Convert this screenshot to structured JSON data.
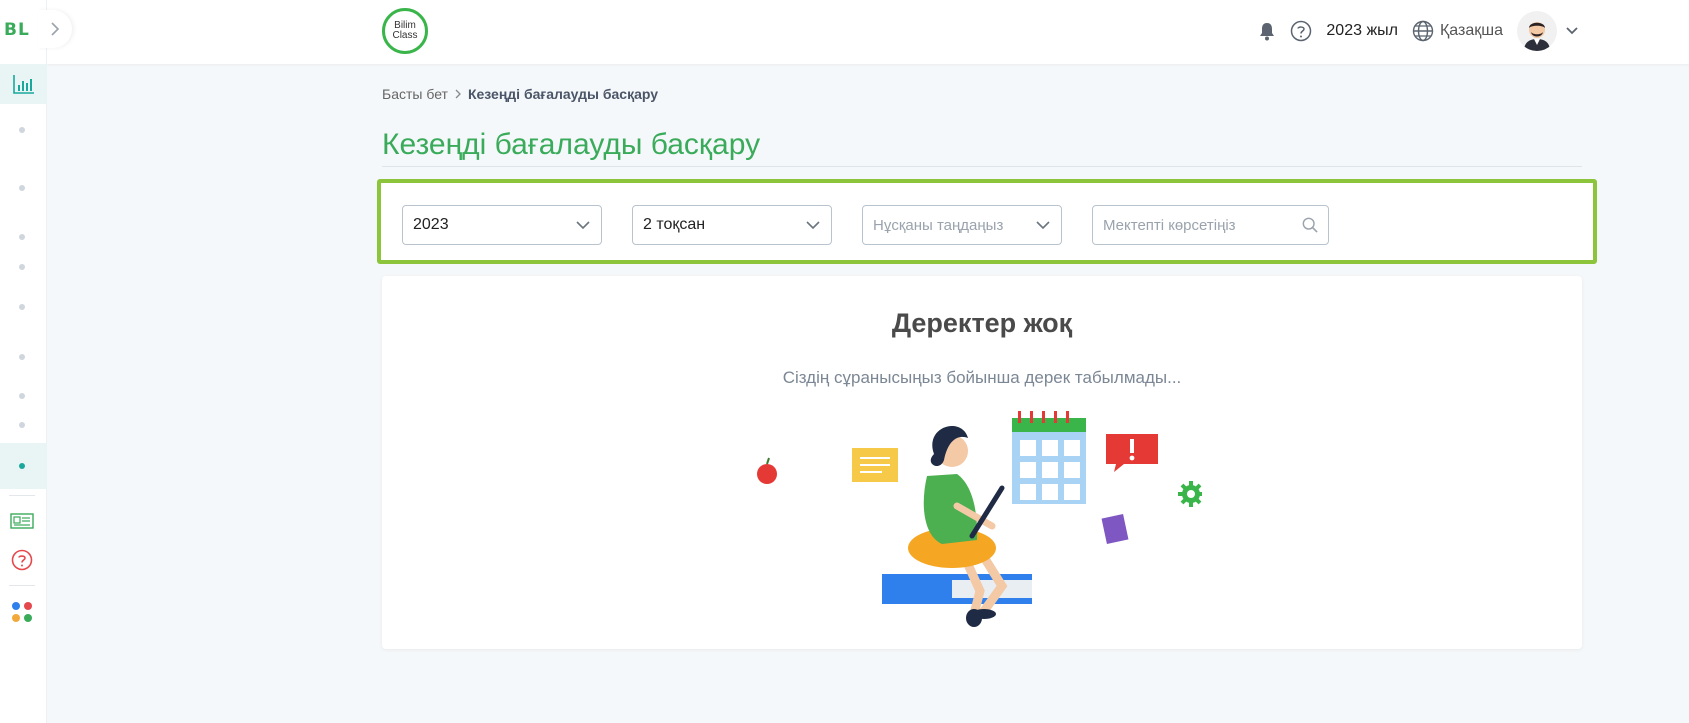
{
  "sidebar": {
    "logo": "BL"
  },
  "header": {
    "brand_line1": "Bilim",
    "brand_line2": "Class",
    "year": "2023 жыл",
    "language": "Қазақша"
  },
  "breadcrumb": {
    "home": "Басты бет",
    "current": "Кезеңді бағалауды басқару"
  },
  "page": {
    "title": "Кезеңді бағалауды басқару"
  },
  "filters": {
    "year_value": "2023",
    "quarter_value": "2 тоқсан",
    "variant_placeholder": "Нұсқаны таңдаңыз",
    "school_placeholder": "Мектепті көрсетіңіз"
  },
  "empty": {
    "title": "Деректер жоқ",
    "subtitle": "Сіздің сұранысыңыз бойынша дерек табылмады..."
  },
  "colors": {
    "accent_green": "#3aab5a",
    "filter_border": "#8cc43b",
    "active_teal": "#1aa89c"
  }
}
